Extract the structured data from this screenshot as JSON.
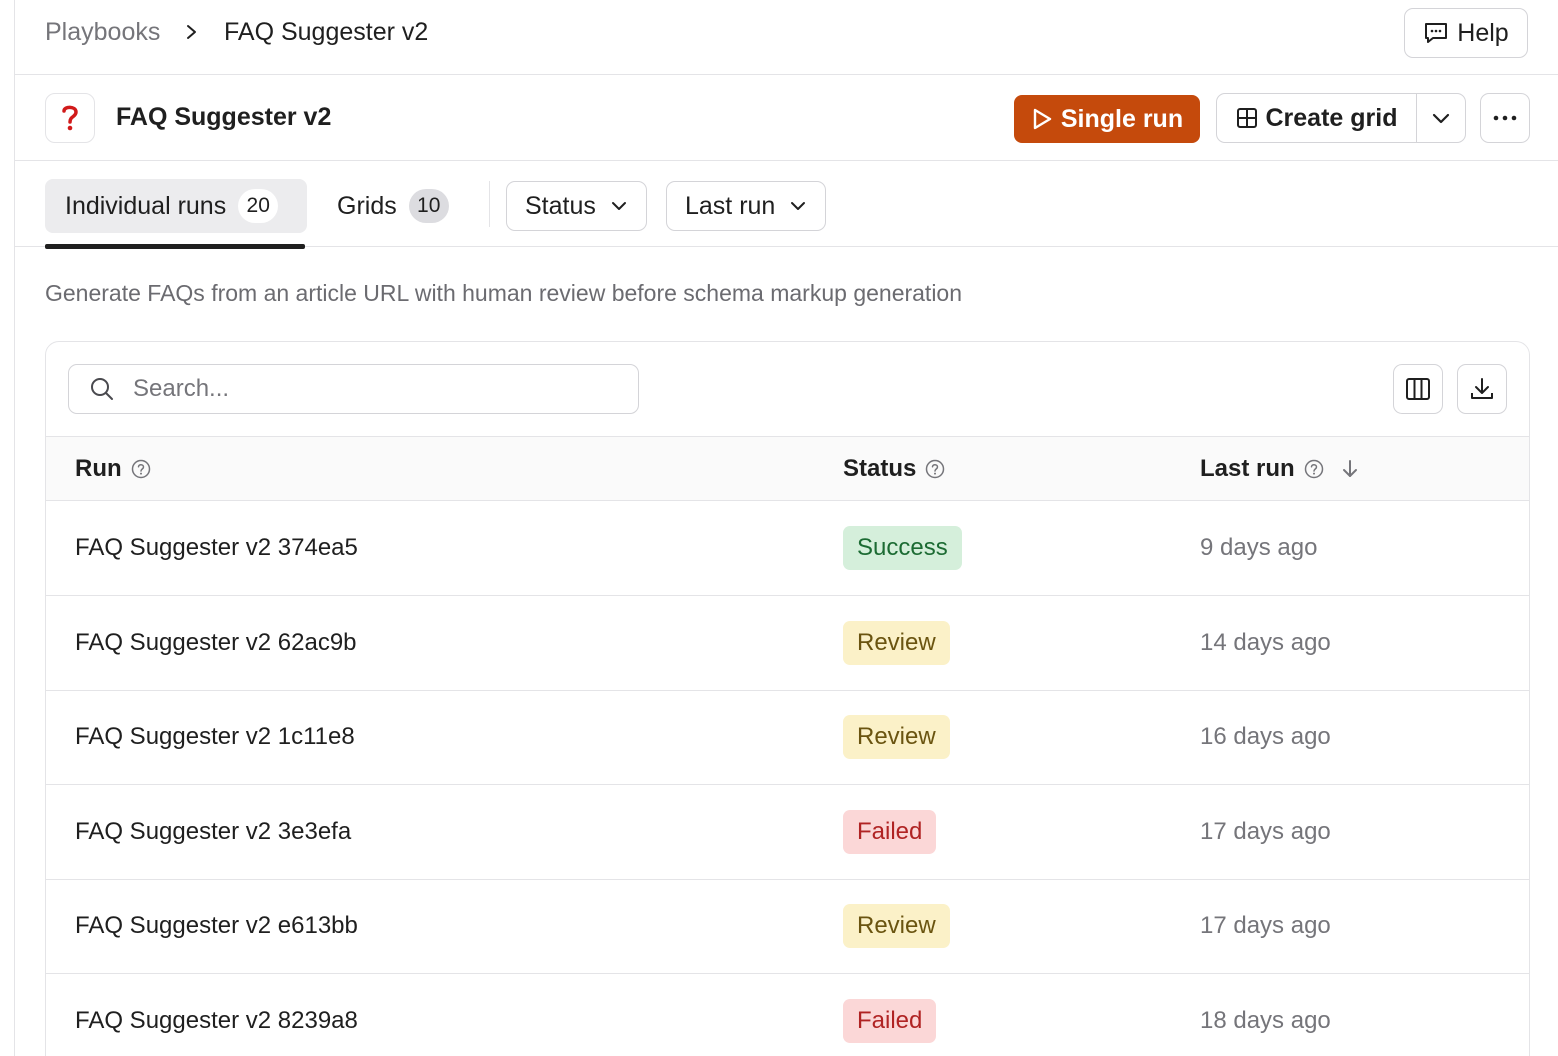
{
  "breadcrumb": {
    "root": "Playbooks",
    "current": "FAQ Suggester v2"
  },
  "header": {
    "help_label": "Help"
  },
  "playbook": {
    "title": "FAQ Suggester v2",
    "icon": "question-mark-icon",
    "icon_color": "#d11a1a"
  },
  "actions": {
    "single_run": "Single run",
    "create_grid": "Create grid",
    "accent": "#c54a0c"
  },
  "tabs": [
    {
      "label": "Individual runs",
      "count": "20",
      "active": true
    },
    {
      "label": "Grids",
      "count": "10",
      "active": false
    }
  ],
  "filters": [
    {
      "label": "Status"
    },
    {
      "label": "Last run"
    }
  ],
  "description": "Generate FAQs from an article URL with human review before schema markup generation",
  "search": {
    "placeholder": "Search..."
  },
  "table": {
    "columns": [
      {
        "label": "Run"
      },
      {
        "label": "Status"
      },
      {
        "label": "Last run"
      }
    ],
    "sort": {
      "column": "Last run",
      "direction": "descending"
    },
    "rows": [
      {
        "run": "FAQ Suggester v2 374ea5",
        "status": "Success",
        "last_run": "9 days ago"
      },
      {
        "run": "FAQ Suggester v2 62ac9b",
        "status": "Review",
        "last_run": "14 days ago"
      },
      {
        "run": "FAQ Suggester v2 1c11e8",
        "status": "Review",
        "last_run": "16 days ago"
      },
      {
        "run": "FAQ Suggester v2 3e3efa",
        "status": "Failed",
        "last_run": "17 days ago"
      },
      {
        "run": "FAQ Suggester v2 e613bb",
        "status": "Review",
        "last_run": "17 days ago"
      },
      {
        "run": "FAQ Suggester v2 8239a8",
        "status": "Failed",
        "last_run": "18 days ago"
      }
    ]
  },
  "status_colors": {
    "Success": "#1c6b33",
    "Review": "#6a5410",
    "Failed": "#b02323"
  }
}
